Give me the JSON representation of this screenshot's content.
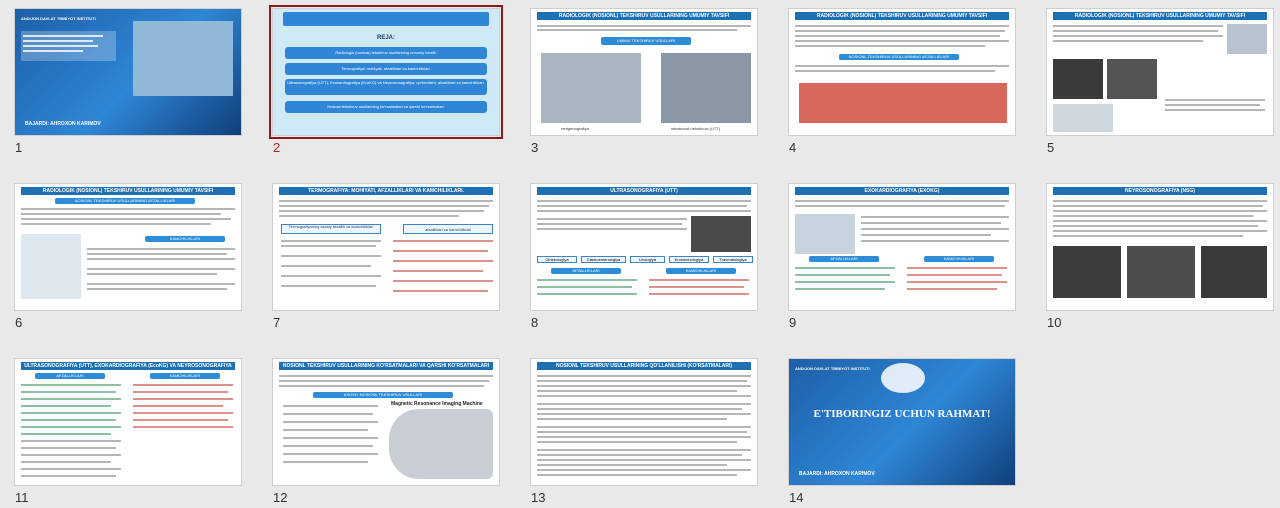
{
  "slides": [
    {
      "number": "1",
      "type": "cover",
      "caption": "BAJARDI:   AHROXON KARIMOV",
      "header": "ANDIJON DAVLAT TIBBIYOT INSTITUTI"
    },
    {
      "number": "2",
      "type": "agenda",
      "heading": "REJA:",
      "items": [
        "Radiologik (nosioal) tekshiruv usullarining umumiy tavsifi.",
        "Termografiya: mohiyati, afzalliklari va kamchiliklari.",
        "Ultrasonografiya (UTT), Exokardiografiya (EcoKG) va Neyrosonografiya: qo'llanilishi, afzalliklari va kamchiliklari.",
        "Nosioal tekshiruv usullarining ko'rsatmalari va qarshi ko'rsatmalari."
      ]
    },
    {
      "number": "3",
      "type": "content",
      "title": "RADIOLOGIK (NOSIONL) TEKSHIRUV USULLARINING UMUMIY TAVSIFI",
      "center_label": "UMMUI TEKSHIRUV USULLARI",
      "img_labels": [
        "rentgenografiya",
        "ultratovush tekshiruvi (UTT)"
      ]
    },
    {
      "number": "4",
      "type": "content",
      "title": "RADIOLOGIK (NOSIONL) TEKSHIRUV USULLARINING UMUMIY TAVSIFI",
      "sub": "NOSIONL TEKSHIRUV USULLARINING AFZALLIKLARI"
    },
    {
      "number": "5",
      "type": "content",
      "title": "RADIOLOGIK (NOSIONL) TEKSHIRUV USULLARINING UMUMIY TAVSIFI"
    },
    {
      "number": "6",
      "type": "content",
      "title": "RADIOLOGIK (NOSIONL) TEKSHIRUV USULLARINING UMUMIY TAVSIFI",
      "sub": "NOSIONL TEKSHIRUV USULLARINING AFZALLIKLARI",
      "sub2": "KAMCHILIKLARI"
    },
    {
      "number": "7",
      "type": "content",
      "title": "TERMOGRAFIYA: MOHIYATI, AFZALLIKLARI VA KAMCHILIKLARI.",
      "sub": "Termografiyaning asosiy afzallik va kamchiliklari",
      "sub2": "afzalliklari va kamchiliklari"
    },
    {
      "number": "8",
      "type": "content",
      "title": "ULTRASONOGRAFIYA (UTT)",
      "tags": [
        "Ginekologiya",
        "Gastroenterologiya",
        "Urologiya",
        "Endokrinologiya",
        "Travmatologiya"
      ],
      "sub": "AFZALLIKLARI",
      "sub2": "KAMCHILIKLARI"
    },
    {
      "number": "9",
      "type": "content",
      "title": "EXOKARDIOGRAFIYA (EXOKG)",
      "sub": "AFZALLIKLARI",
      "sub2": "KAMCHILIKLARI"
    },
    {
      "number": "10",
      "type": "content",
      "title": "NEYROSONOGRAFIYA (NSG)"
    },
    {
      "number": "11",
      "type": "content",
      "title": "ULTRASONOGRAFIYA (UTT), EXOKARDIOGRAFIYA (EcoKG) VA NEYROSONOGRAFIYA",
      "sub": "AFZALLIKLARI",
      "sub2": "KAMCHILIKLARI"
    },
    {
      "number": "12",
      "type": "content",
      "title": "NOSIONL TEKSHIRUV USULLARINING KO'RSATMALARI VA QARSHI KO'RSATMALARI",
      "sub": "ASOSIY NOSIONL TEKSHIRUV USULLARI",
      "img_label": "Magnetic Resonance Imaging Machine"
    },
    {
      "number": "13",
      "type": "content",
      "title": "NOSIONL TEKSHIRUV USULLARINING QO'LLANILISHI (KO'RSATMALARI)"
    },
    {
      "number": "14",
      "type": "cover",
      "caption": "BAJARDI:   AHROXON KARIMOV",
      "header": "ANDIJON DAVLAT TIBBIYOT INSTITUTI",
      "big": "E'TIBORINGIZ UCHUN RAHMAT!"
    }
  ],
  "selected_slide": "2",
  "colors": {
    "accent": "#1f6fb3",
    "selection": "#8b1a1a",
    "background": "#e9e9e9"
  }
}
